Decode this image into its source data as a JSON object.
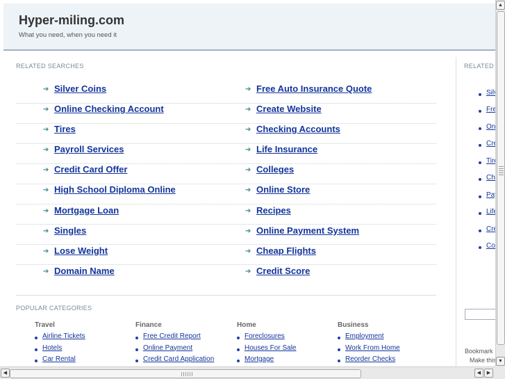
{
  "header": {
    "site_title": "Hyper-miling.com",
    "tagline": "What you need, when you need it"
  },
  "related_searches": {
    "label": "RELATED SEARCHES",
    "left": [
      "Silver Coins",
      "Online Checking Account",
      "Tires",
      "Payroll Services",
      "Credit Card Offer",
      "High School Diploma Online",
      "Mortgage Loan",
      "Singles",
      "Lose Weight",
      "Domain Name"
    ],
    "right": [
      "Free Auto Insurance Quote",
      "Create Website",
      "Checking Accounts",
      "Life Insurance",
      "Colleges",
      "Online Store",
      "Recipes",
      "Online Payment System",
      "Cheap Flights",
      "Credit Score"
    ]
  },
  "popular_categories": {
    "label": "POPULAR CATEGORIES",
    "columns": [
      {
        "title": "Travel",
        "items": [
          "Airline Tickets",
          "Hotels",
          "Car Rental"
        ]
      },
      {
        "title": "Finance",
        "items": [
          "Free Credit Report",
          "Online Payment",
          "Credit Card Application"
        ]
      },
      {
        "title": "Home",
        "items": [
          "Foreclosures",
          "Houses For Sale",
          "Mortgage"
        ]
      },
      {
        "title": "Business",
        "items": [
          "Employment",
          "Work From Home",
          "Reorder Checks"
        ]
      }
    ]
  },
  "right_panel": {
    "label": "RELATED",
    "items": [
      "Silv",
      "Free",
      "Onl",
      "Cre",
      "Tire",
      "Che",
      "Pay",
      "Life",
      "Cre",
      "Coll"
    ],
    "bookmark_text": "Bookmark",
    "make_this_text": "Make this"
  },
  "colors": {
    "link": "#13349c",
    "header_bg": "#eef3f7",
    "arrow": "#3b8a8e"
  },
  "icons": {
    "link_arrow": "arrow-right-icon",
    "scroll_up": "triangle-up-icon",
    "scroll_down": "triangle-down-icon",
    "scroll_left": "triangle-left-icon",
    "scroll_right": "triangle-right-icon"
  }
}
